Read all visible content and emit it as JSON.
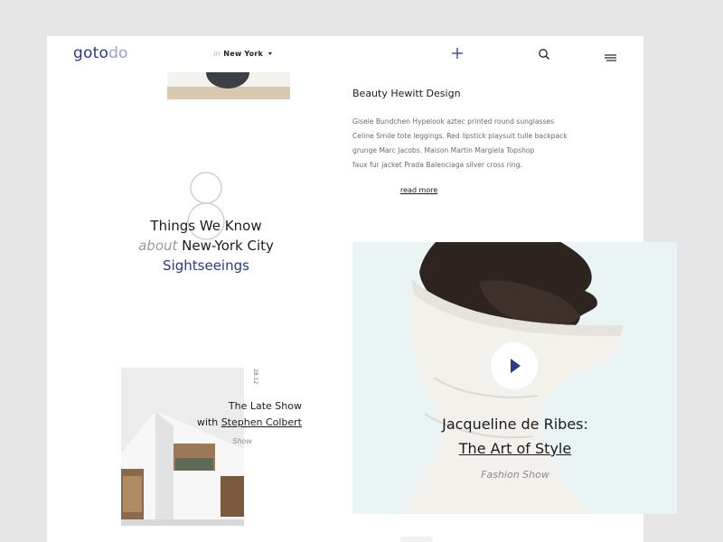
{
  "header": {
    "logo_part1": "goto",
    "logo_part2": "do",
    "location_prefix": "in",
    "location_city": "New York"
  },
  "article": {
    "title": "Beauty Hewitt Design",
    "lines": [
      "Gisele Bundchen Hypelook aztec printed round sunglasses",
      "Celine Smile tote leggings. Red lipstick playsuit tulle backpack",
      "grunge Marc Jacobs. Maison Martin Margiela Topshop",
      "faux fur jacket Prada Balenciaga silver cross ring."
    ],
    "read_more": "read more"
  },
  "things": {
    "number": "8",
    "line1": "Things We Know",
    "about": "about",
    "city": "New-York City",
    "line3": "Sightseeings"
  },
  "show": {
    "date": "28.12",
    "line1": "The Late Show",
    "with": "with",
    "host": "Stephen Colbert",
    "tag": "Show"
  },
  "feature": {
    "title_line1": "Jacqueline de Ribes:",
    "title_line2": "The Art of Style",
    "tag": "Fashion Show"
  },
  "colors": {
    "accent": "#2b3b82",
    "feature_bg": "#eaf4f5",
    "page_bg": "#e6e6e6"
  },
  "icons": [
    "plus-icon",
    "search-icon",
    "menu-icon",
    "caret-down-icon",
    "play-icon"
  ]
}
